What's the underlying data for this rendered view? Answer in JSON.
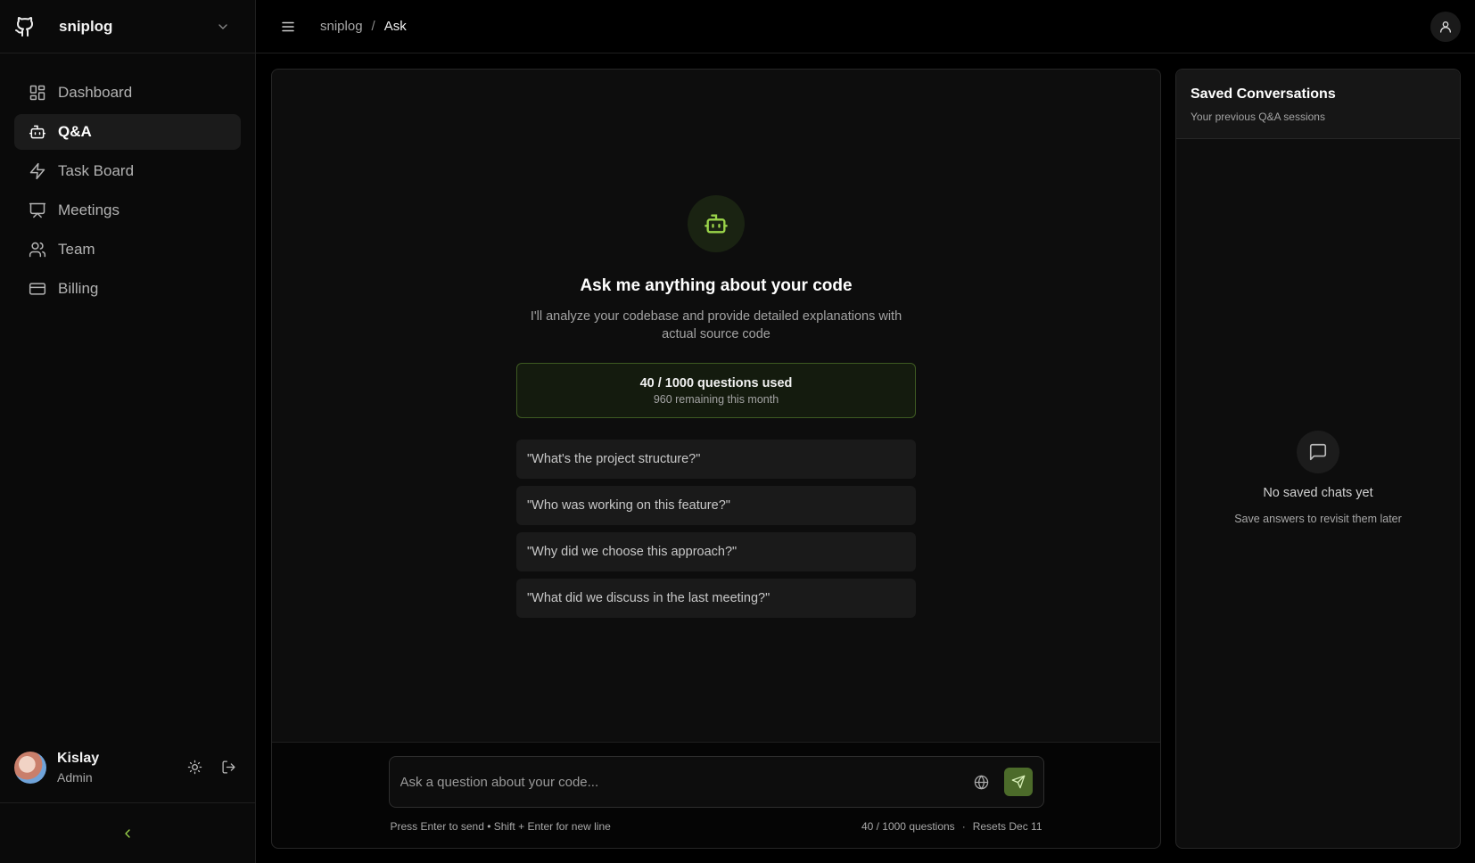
{
  "sidebar": {
    "project": "sniplog",
    "nav": [
      {
        "label": "Dashboard",
        "icon": "dashboard-icon"
      },
      {
        "label": "Q&A",
        "icon": "bot-icon",
        "active": true
      },
      {
        "label": "Task Board",
        "icon": "zap-icon"
      },
      {
        "label": "Meetings",
        "icon": "presentation-icon"
      },
      {
        "label": "Team",
        "icon": "users-icon"
      },
      {
        "label": "Billing",
        "icon": "credit-card-icon"
      }
    ],
    "user": {
      "name": "Kislay",
      "role": "Admin"
    }
  },
  "topbar": {
    "breadcrumb": {
      "parent": "sniplog",
      "separator": "/",
      "current": "Ask"
    }
  },
  "chat": {
    "title": "Ask me anything about your code",
    "description": "I'll analyze your codebase and provide detailed explanations with actual source code",
    "usage": {
      "main": "40 / 1000 questions used",
      "sub": "960 remaining this month"
    },
    "suggestions": [
      "\"What's the project structure?\"",
      "\"Who was working on this feature?\"",
      "\"Why did we choose this approach?\"",
      "\"What did we discuss in the last meeting?\""
    ],
    "input": {
      "placeholder": "Ask a question about your code...",
      "value": ""
    },
    "footer": {
      "hint": "Press Enter to send • Shift + Enter for new line",
      "count": "40 / 1000 questions",
      "dot": "·",
      "resets": "Resets Dec 11"
    }
  },
  "saved": {
    "title": "Saved Conversations",
    "subtitle": "Your previous Q&A sessions",
    "empty_title": "No saved chats yet",
    "empty_sub": "Save answers to revisit them later"
  },
  "colors": {
    "accent": "#9bd44a",
    "send_button": "#4c6b2a",
    "usage_border": "#3e5a22"
  }
}
